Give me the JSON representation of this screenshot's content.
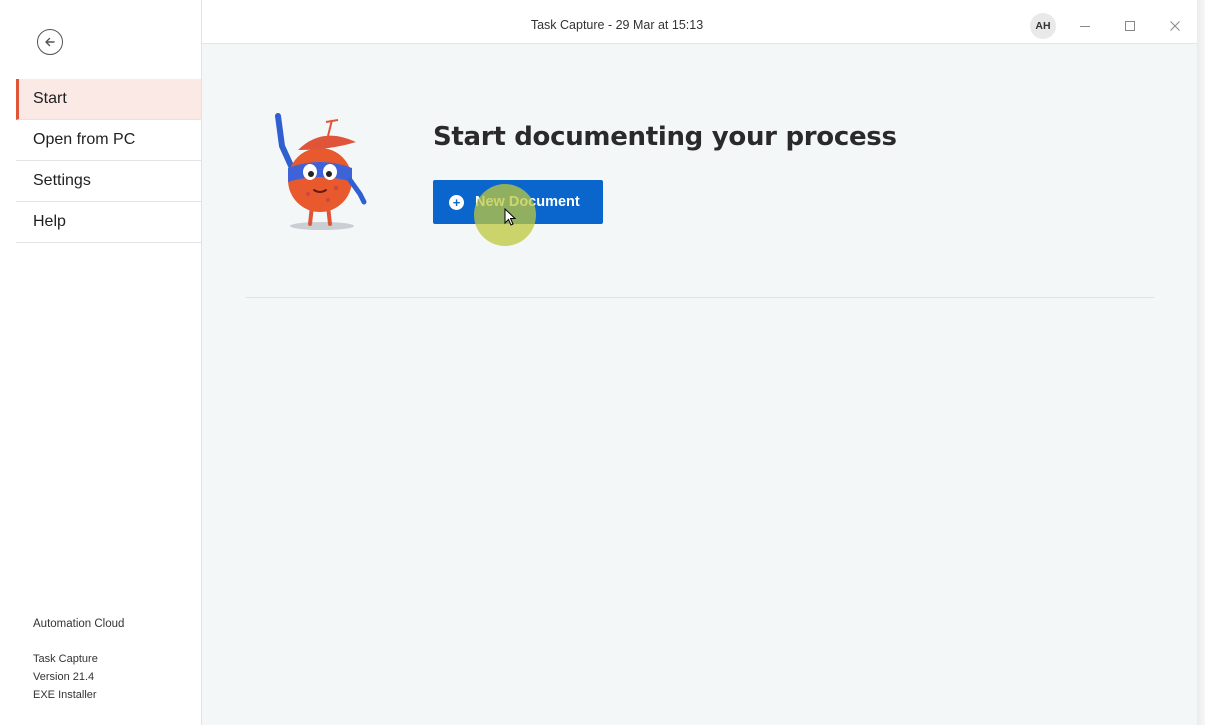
{
  "window": {
    "title": "Task Capture - 29 Mar at 15:13",
    "avatar_initials": "AH",
    "controls": [
      "minimize-icon",
      "maximize-icon",
      "close-icon"
    ]
  },
  "sidebar": {
    "back_icon": "arrow-left-circle-icon",
    "items": [
      {
        "label": "Start",
        "active": true
      },
      {
        "label": "Open from PC",
        "active": false
      },
      {
        "label": "Settings",
        "active": false
      },
      {
        "label": "Help",
        "active": false
      }
    ],
    "footer": {
      "cloud_label": "Automation Cloud",
      "product": "Task Capture",
      "version": "Version 21.4",
      "installer": "EXE Installer"
    }
  },
  "main": {
    "heading": "Start documenting your process",
    "new_document_label": "New Document",
    "new_document_icon": "plus-circle-icon"
  },
  "colors": {
    "accent": "#e0553a",
    "active_bg": "#fbe9e6",
    "primary_button": "#0a66cc",
    "main_bg": "#f3f7f8"
  }
}
